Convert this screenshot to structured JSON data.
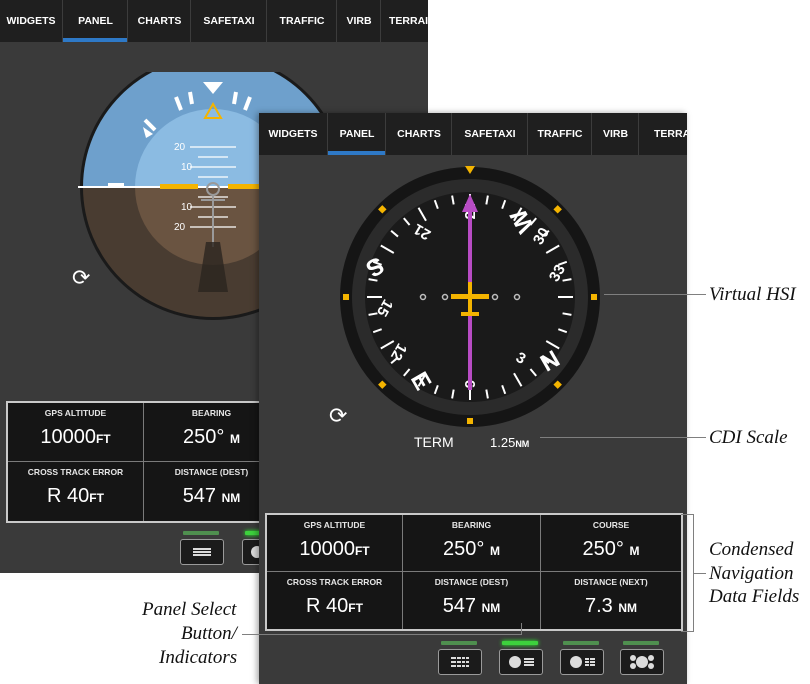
{
  "tabs": [
    "WIDGETS",
    "PANEL",
    "CHARTS",
    "SAFETAXI",
    "TRAFFIC",
    "VIRB",
    "TERRAIN"
  ],
  "active_tab": "PANEL",
  "attitude": {
    "pitch_labels": [
      "20",
      "10",
      "10",
      "20"
    ]
  },
  "hsi": {
    "cardinals": [
      "W",
      "N",
      "E",
      "S"
    ],
    "numbers": [
      "24",
      "30",
      "33",
      "3",
      "6",
      "12",
      "15",
      "21"
    ],
    "cdi_mode": "TERM",
    "cdi_scale_value": "1.25",
    "cdi_scale_unit": "NM"
  },
  "fields": [
    {
      "label": "GPS ALTITUDE",
      "value": "10000",
      "unit": "FT"
    },
    {
      "label": "BEARING",
      "value": "250°",
      "unit": "M"
    },
    {
      "label": "COURSE",
      "value": "250°",
      "unit": "M"
    },
    {
      "label": "CROSS TRACK ERROR",
      "value": "R 40",
      "unit": "FT"
    },
    {
      "label": "DISTANCE (DEST)",
      "value": "547",
      "unit": "NM"
    },
    {
      "label": "DISTANCE (NEXT)",
      "value": "7.3",
      "unit": "NM"
    }
  ],
  "callouts": {
    "hsi": "Virtual HSI",
    "cdi": "CDI Scale",
    "fields_1": "Condensed",
    "fields_2": "Navigation",
    "fields_3": "Data Fields",
    "panel_1": "Panel Select",
    "panel_2": "Button/",
    "panel_3": "Indicators"
  },
  "colors": {
    "magenta": "#b84cc4",
    "yellow": "#f4b400",
    "tab_underline": "#2e79c7",
    "indicator_on": "#3dd13d"
  }
}
